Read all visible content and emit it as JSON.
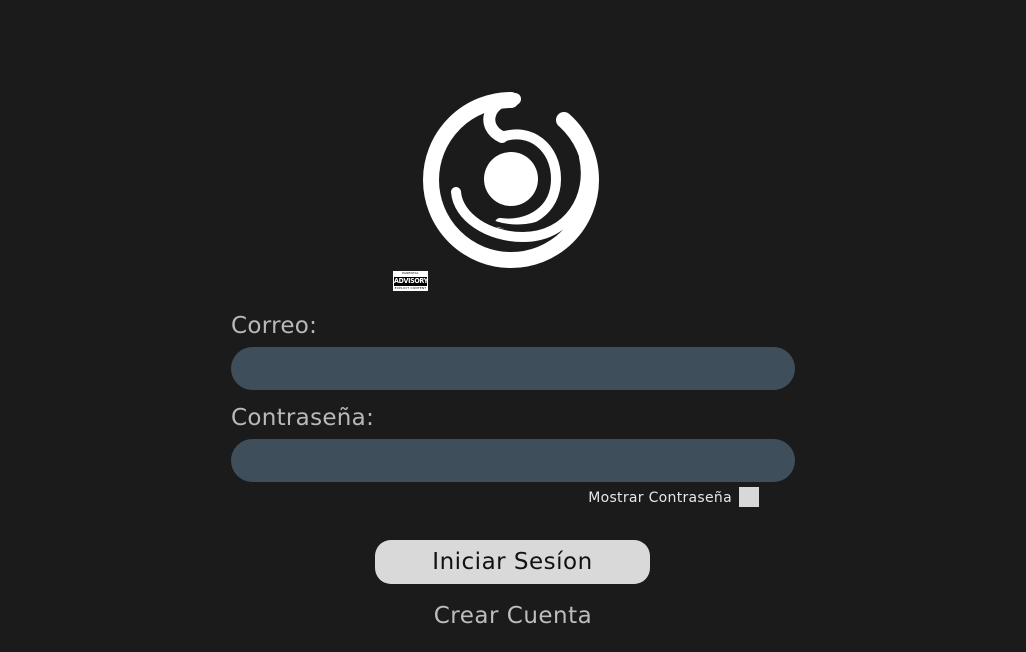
{
  "logo": {
    "icon": "spiral-disc-logo-icon",
    "color": "#ffffff"
  },
  "advisory_badge": {
    "top": "PARENTAL",
    "middle": "ADVISORY",
    "bottom": "EXPLICIT CONTENT"
  },
  "form": {
    "email_label": "Correo:",
    "email_value": "",
    "password_label": "Contraseña:",
    "password_value": "",
    "show_password_label": "Mostrar Contraseña",
    "show_password_checked": false,
    "login_button": "Iniciar Sesíon",
    "create_account_link": "Crear Cuenta"
  },
  "colors": {
    "background": "#1b1b1c",
    "field": "#3e4f5b",
    "button": "#d9d9d9",
    "label": "#b9b9b9"
  }
}
